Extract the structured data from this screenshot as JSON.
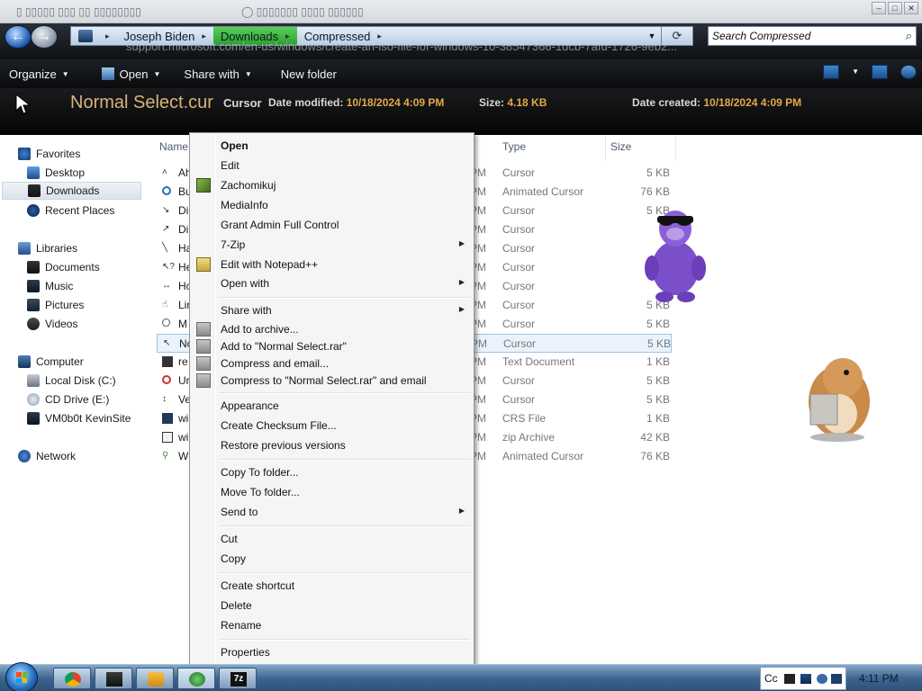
{
  "browser": {
    "url": "support.microsoft.com/en-us/windows/create-an-iso-file-for-windows-10-38547366-1dcb-7afd-1726-9eb2..."
  },
  "address_bar": {
    "segments": [
      "Joseph Biden",
      "Downloads",
      "Compressed"
    ],
    "active_segment": "Downloads"
  },
  "search": {
    "placeholder": "Search Compressed"
  },
  "command_bar": {
    "organize": "Organize",
    "open": "Open",
    "share_with": "Share with",
    "new_folder": "New folder"
  },
  "details": {
    "file_name": "Normal Select.cur",
    "file_type": "Cursor",
    "date_modified_label": "Date modified:",
    "date_modified": "10/18/2024 4:09 PM",
    "size_label": "Size:",
    "size": "4.18 KB",
    "date_created_label": "Date created:",
    "date_created": "10/18/2024 4:09 PM"
  },
  "nav_pane": {
    "favorites": "Favorites",
    "desktop": "Desktop",
    "downloads": "Downloads",
    "recent_places": "Recent Places",
    "libraries": "Libraries",
    "documents": "Documents",
    "music": "Music",
    "pictures": "Pictures",
    "videos": "Videos",
    "computer": "Computer",
    "local_disk": "Local Disk (C:)",
    "cd_drive": "CD Drive (E:)",
    "vm_share": "VM0b0t KevinSite",
    "network": "Network"
  },
  "file_list": {
    "columns": {
      "name": "Name",
      "type": "Type",
      "size": "Size"
    },
    "rows": [
      {
        "name": "Ah",
        "date": "PM",
        "type": "Cursor",
        "size": "5 KB"
      },
      {
        "name": "Bu",
        "date": "PM",
        "type": "Animated Cursor",
        "size": "76 KB"
      },
      {
        "name": "Di",
        "date": "PM",
        "type": "Cursor",
        "size": "5 KB"
      },
      {
        "name": "Di",
        "date": "PM",
        "type": "Cursor",
        "size": "5"
      },
      {
        "name": "Ha",
        "date": "PM",
        "type": "Cursor",
        "size": "5"
      },
      {
        "name": "He",
        "date": "PM",
        "type": "Cursor",
        "size": ""
      },
      {
        "name": "Ho",
        "date": "PM",
        "type": "Cursor",
        "size": ""
      },
      {
        "name": "Lir",
        "date": "PM",
        "type": "Cursor",
        "size": "5 KB"
      },
      {
        "name": "M",
        "date": "PM",
        "type": "Cursor",
        "size": "5 KB"
      },
      {
        "name": "No",
        "date": "PM",
        "type": "Cursor",
        "size": "5 KB"
      },
      {
        "name": "re",
        "date": "PM",
        "type": "Text Document",
        "size": "1 KB"
      },
      {
        "name": "Ur",
        "date": "PM",
        "type": "Cursor",
        "size": "5 KB"
      },
      {
        "name": "Ve",
        "date": "PM",
        "type": "Cursor",
        "size": "5 KB"
      },
      {
        "name": "wi",
        "date": "PM",
        "type": "CRS File",
        "size": "1 KB"
      },
      {
        "name": "wi",
        "date": "PM",
        "type": "zip Archive",
        "size": "42 KB"
      },
      {
        "name": "W",
        "date": "PM",
        "type": "Animated Cursor",
        "size": "76 KB"
      }
    ]
  },
  "context_menu": {
    "open": "Open",
    "edit": "Edit",
    "zachomikuj": "Zachomikuj",
    "mediainfo": "MediaInfo",
    "grant_admin": "Grant Admin Full Control",
    "seven_zip": "7-Zip",
    "edit_npp": "Edit with Notepad++",
    "open_with": "Open with",
    "share_with": "Share with",
    "add_archive": "Add to archive...",
    "add_rar": "Add to \"Normal Select.rar\"",
    "compress_email": "Compress and email...",
    "compress_rar_email": "Compress to \"Normal Select.rar\" and email",
    "appearance": "Appearance",
    "checksum": "Create Checksum File...",
    "restore": "Restore previous versions",
    "copy_to": "Copy To folder...",
    "move_to": "Move To folder...",
    "send_to": "Send to",
    "cut": "Cut",
    "copy": "Copy",
    "create_shortcut": "Create shortcut",
    "delete": "Delete",
    "rename": "Rename",
    "properties": "Properties"
  },
  "taskbar": {
    "clock": "4:11 PM",
    "tray_text": "Cc"
  },
  "icons": {
    "start": "windows-start-orb",
    "chrome": "chrome-icon",
    "folder": "explorer-icon",
    "media": "media-player-icon",
    "globe": "network-globe-icon",
    "seven_zip": "7zip-icon"
  },
  "colors": {
    "title_accent": "#d9b47a",
    "meta_accent": "#e3a84b",
    "breadcrumb_active": "#3fb83f",
    "header_bg": "#0a0b0d"
  }
}
